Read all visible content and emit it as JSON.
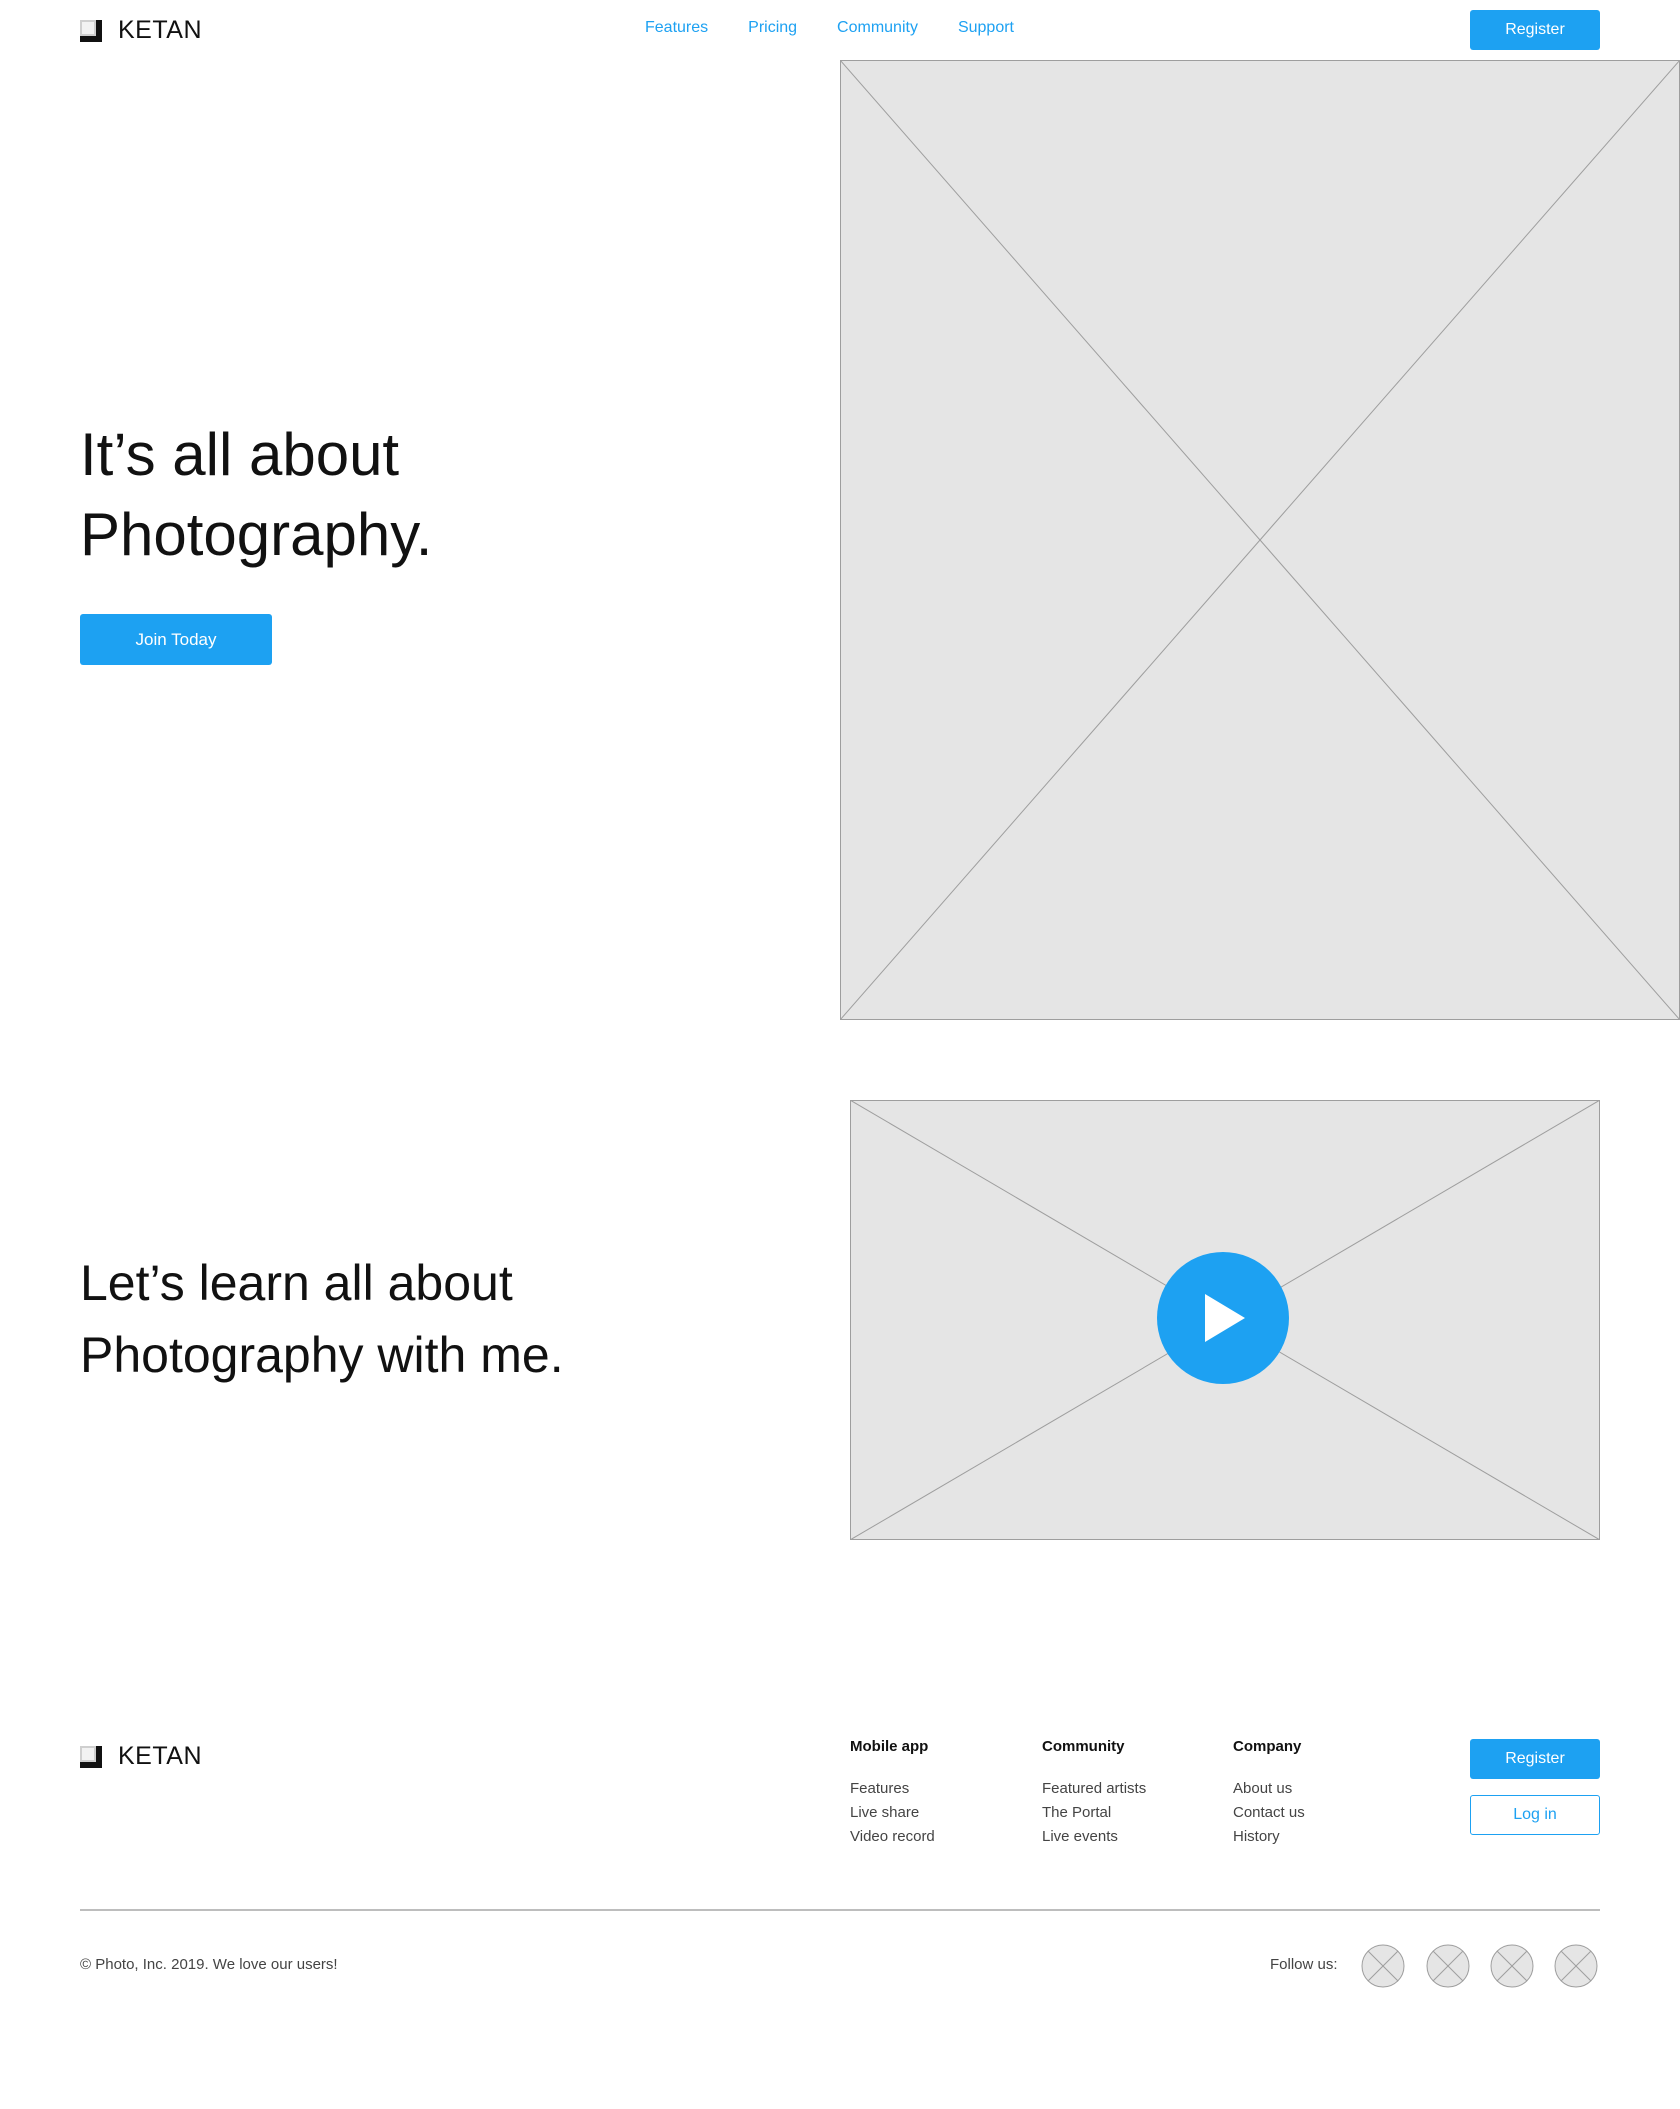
{
  "header": {
    "logo_text": "KETAN",
    "nav": [
      "Features",
      "Pricing",
      "Community",
      "Support"
    ],
    "register_label": "Register"
  },
  "hero": {
    "title_line1": "It’s all about",
    "title_line2": "Photography.",
    "cta_label": "Join Today"
  },
  "video_section": {
    "title_line1": "Let’s learn all about",
    "title_line2": "Photography with me."
  },
  "footer": {
    "logo_text": "KETAN",
    "columns": [
      {
        "heading": "Mobile app",
        "items": [
          "Features",
          "Live share",
          "Video record"
        ]
      },
      {
        "heading": "Community",
        "items": [
          "Featured artists",
          "The Portal",
          "Live events"
        ]
      },
      {
        "heading": "Company",
        "items": [
          "About us",
          "Contact us",
          "History"
        ]
      }
    ],
    "register_label": "Register",
    "login_label": "Log in",
    "copyright": "© Photo, Inc. 2019. We love our users!",
    "follow_label": "Follow us:"
  },
  "colors": {
    "accent": "#1da1f2",
    "placeholder_fill": "#e5e5e5",
    "placeholder_stroke": "#9e9e9e"
  },
  "icons": {
    "logo": "cube-logo-icon",
    "play": "play-icon",
    "social": [
      "social-icon-1",
      "social-icon-2",
      "social-icon-3",
      "social-icon-4"
    ]
  }
}
